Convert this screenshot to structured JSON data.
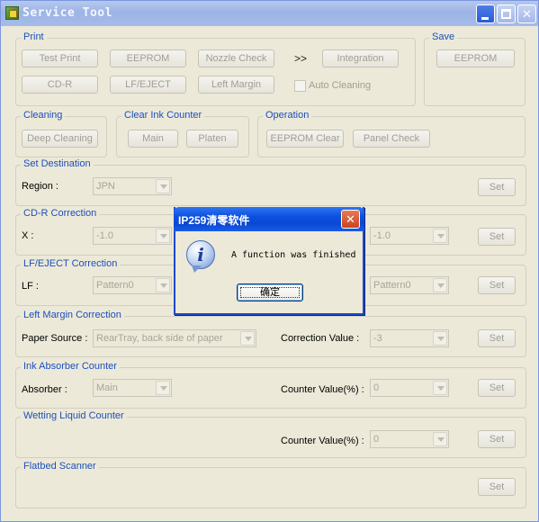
{
  "window": {
    "title": "Service Tool"
  },
  "print": {
    "legend": "Print",
    "buttons": [
      "Test Print",
      "EEPROM",
      "Nozzle Check",
      "Integration",
      "CD-R",
      "LF/EJECT",
      "Left Margin"
    ],
    "chevron": ">>",
    "auto_cleaning_label": "Auto Cleaning"
  },
  "save": {
    "legend": "Save",
    "eeprom": "EEPROM"
  },
  "cleaning": {
    "legend": "Cleaning",
    "deep": "Deep Cleaning"
  },
  "clear_ink": {
    "legend": "Clear Ink Counter",
    "main": "Main",
    "platen": "Platen"
  },
  "operation": {
    "legend": "Operation",
    "eeprom_clear": "EEPROM Clear",
    "panel_check": "Panel Check"
  },
  "set_destination": {
    "legend": "Set Destination",
    "region_label": "Region :",
    "region_value": "JPN",
    "set": "Set"
  },
  "cdr": {
    "legend": "CD-R Correction",
    "x_label": "X :",
    "x_value": "-1.0",
    "y_value": "-1.0",
    "set": "Set"
  },
  "lf_eject": {
    "legend": "LF/EJECT Correction",
    "lf_label": "LF :",
    "lf_value": "Pattern0",
    "eject_value": "Pattern0",
    "set": "Set"
  },
  "left_margin": {
    "legend": "Left Margin Correction",
    "paper_source_label": "Paper Source :",
    "paper_source_value": "RearTray, back side of paper",
    "correction_label": "Correction Value :",
    "correction_value": "-3",
    "set": "Set"
  },
  "ink_absorber": {
    "legend": "Ink Absorber Counter",
    "absorber_label": "Absorber :",
    "absorber_value": "Main",
    "counter_label": "Counter Value(%) :",
    "counter_value": "0",
    "set": "Set"
  },
  "wetting": {
    "legend": "Wetting Liquid Counter",
    "counter_label": "Counter Value(%) :",
    "counter_value": "0",
    "set": "Set"
  },
  "flatbed": {
    "legend": "Flatbed Scanner",
    "set": "Set"
  },
  "dialog": {
    "title": "IP259清零软件",
    "message": "A function was finished",
    "ok": "确定"
  }
}
